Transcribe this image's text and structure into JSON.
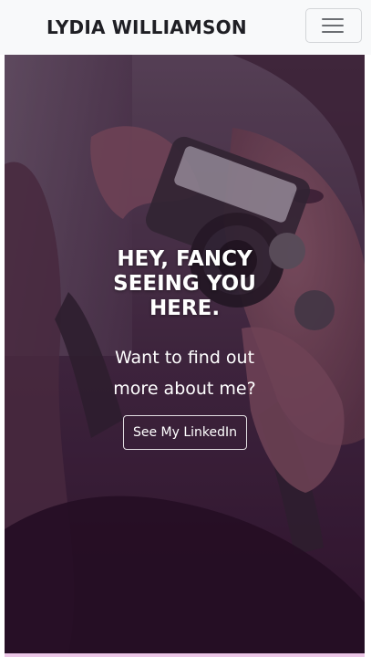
{
  "navbar": {
    "brand": "LYDIA WILLIAMSON",
    "toggler_icon": "hamburger-menu-icon"
  },
  "hero": {
    "heading_lines": [
      "HEY, FANCY",
      "SEEING YOU",
      "HERE."
    ],
    "subheading_lines": [
      "Want to find out",
      "more about me?"
    ],
    "cta_label": "See My LinkedIn",
    "photo_description_icon": "camera-photo"
  },
  "colors": {
    "navbar_bg": "#f8f9fa",
    "brand_text": "#1f1f24",
    "hero_tint": "#3a2337",
    "accent_strip": "#ecc6e6"
  }
}
